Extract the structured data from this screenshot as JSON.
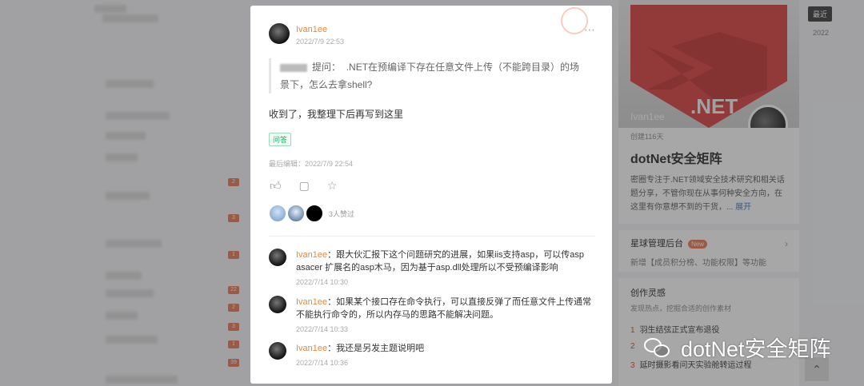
{
  "post": {
    "author": "Ivan1ee",
    "time": "2022/7/9 22:53",
    "quote_label": "提问：",
    "quote_text": ".NET在预编译下存在任意文件上传（不能跨目录）的场景下，怎么去拿shell?",
    "body": "收到了，我整理下后再写到这里",
    "tag": "问答",
    "last_edited": "最后编辑：2022/7/9 22:54",
    "likes_text": "3人赞过",
    "more_icon": "⋯"
  },
  "comments": [
    {
      "author": "Ivan1ee",
      "text": "：跟大伙汇报下这个问题研究的进展，如果iis支持asp，可以传asp asacer 扩展名的asp木马，因为基于asp.dll处理所以不受预编译影响",
      "time": "2022/7/14 10:30"
    },
    {
      "author": "Ivan1ee",
      "text": "：如果某个接口存在命令执行，可以直接反弹了而任意文件上传通常不能执行命令的，所以内存马的思路不能解决问题。",
      "time": "2022/7/14 10:33"
    },
    {
      "author": "Ivan1ee",
      "text": "：我还是另发主题说明吧",
      "time": "2022/7/14 10:36"
    }
  ],
  "right": {
    "banner_user": "Ivan1ee",
    "banner_net": ".NET",
    "created": "创建116天",
    "title": "dotNet安全矩阵",
    "desc": "密圈专注于.NET领域安全技术研究和相关话题分享，不管你现在从事何种安全方向，在这里有你意想不到的干货，...",
    "expand": "展开",
    "admin_title": "星球管理后台",
    "admin_badge": "New",
    "admin_sub": "新增【成员积分榜、功能权限】等功能",
    "inspire_title": "创作灵感",
    "inspire_sub": "发现热点，挖掘合适的创作素材",
    "inspire_items": [
      {
        "num": "1",
        "text": "羽生结弦正式宣布退役"
      },
      {
        "num": "2",
        "text": ""
      },
      {
        "num": "3",
        "text": "延时摄影看问天实验舱转运过程"
      }
    ],
    "recent": "最近",
    "year": "2022",
    "top_icon": "⌃"
  },
  "left_badges": [
    "2",
    "3",
    "1",
    "22",
    "2",
    "3",
    "1",
    "39"
  ],
  "watermark": "dotNet安全矩阵",
  "colors": {
    "accent": "#e7893a",
    "tag_green": "#2aa86f",
    "badge_orange": "#e8734d",
    "shield_red": "#d9393a"
  }
}
